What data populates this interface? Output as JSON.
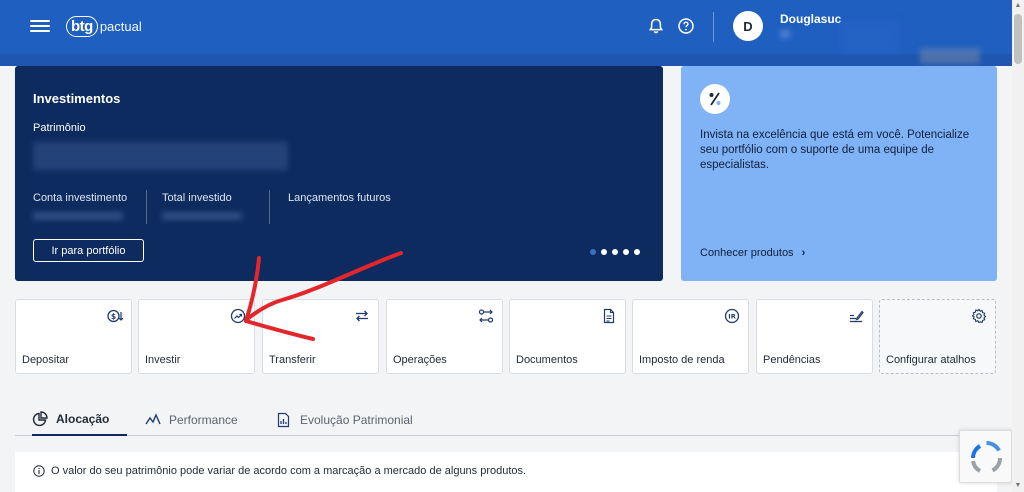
{
  "header": {
    "logo_mark": "btg",
    "logo_text": "pactual",
    "avatar_initial": "D",
    "user_name": "Douglasuc"
  },
  "investimentos": {
    "title": "Investimentos",
    "patrimonio_label": "Patrimônio",
    "stats": [
      {
        "label": "Conta investimento"
      },
      {
        "label": "Total investido"
      },
      {
        "label": "Lançamentos futuros"
      }
    ],
    "button_label": "Ir para portfólio"
  },
  "promo": {
    "text": "Invista na excelência que está em você. Potencialize seu portfólio com o suporte de uma equipe de especialistas.",
    "link_label": "Conhecer produtos",
    "link_arrow": "›"
  },
  "shortcuts": [
    {
      "label": "Depositar",
      "icon": "deposit-icon"
    },
    {
      "label": "Investir",
      "icon": "invest-icon"
    },
    {
      "label": "Transferir",
      "icon": "transfer-icon"
    },
    {
      "label": "Operações",
      "icon": "operations-icon"
    },
    {
      "label": "Documentos",
      "icon": "document-icon"
    },
    {
      "label": "Imposto de renda",
      "icon": "ir-icon"
    },
    {
      "label": "Pendências",
      "icon": "pending-icon"
    },
    {
      "label": "Configurar atalhos",
      "icon": "gear-icon"
    }
  ],
  "tabs": [
    {
      "label": "Alocação",
      "active": true
    },
    {
      "label": "Performance",
      "active": false
    },
    {
      "label": "Evolução Patrimonial",
      "active": false
    }
  ],
  "notice": {
    "text": "O valor do seu patrimônio pode variar de acordo com a marcação a mercado de alguns produtos."
  },
  "colors": {
    "header_blue": "#1e5fbf",
    "card_navy": "#0d2b5e",
    "promo_blue": "#7fb3f6",
    "annotation_red": "#e3262b"
  }
}
